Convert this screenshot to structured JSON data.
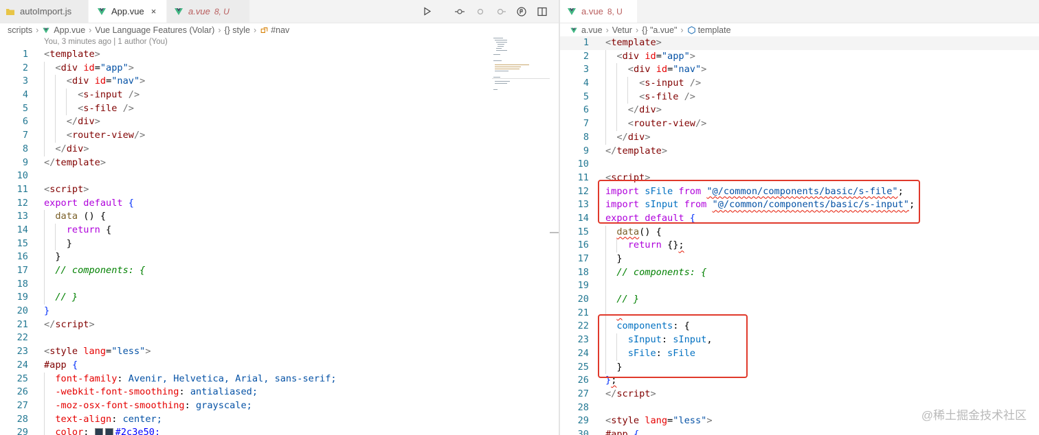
{
  "left": {
    "tabs": [
      {
        "label": "autoImport.js",
        "icon": "js-file-icon"
      },
      {
        "label": "App.vue",
        "icon": "vue-file-icon",
        "close": "×"
      },
      {
        "label": "a.vue",
        "icon": "vue-file-icon",
        "status": "8, U"
      }
    ],
    "actions": [
      "run-icon",
      "open-changes-icon",
      "go-back-icon",
      "go-forward-icon",
      "timeline-icon",
      "split-editor-icon",
      "more-icon"
    ],
    "breadcrumb": [
      "scripts",
      "App.vue",
      "Vue Language Features (Volar)",
      "{} style",
      "#nav"
    ],
    "blame": "You, 3 minutes ago | 1 author (You)",
    "line_numbers": [
      "1",
      "2",
      "3",
      "4",
      "5",
      "6",
      "7",
      "8",
      "9",
      "10",
      "11",
      "12",
      "13",
      "14",
      "15",
      "16",
      "17",
      "18",
      "19",
      "20",
      "21",
      "22",
      "23",
      "24",
      "25",
      "26",
      "27",
      "28",
      "29"
    ],
    "code": {
      "l1": "template",
      "l2a": "div",
      "l2b": "id",
      "l2c": "\"app\"",
      "l3a": "div",
      "l3b": "id",
      "l3c": "\"nav\"",
      "l4": "s-input",
      "l5": "s-file",
      "l6": "div",
      "l7": "router-view",
      "l8": "div",
      "l9": "template",
      "l11": "script",
      "l12a": "export",
      "l12b": "default",
      "l13": "data",
      "l14": "return",
      "l17": "// components: {",
      "l19": "// }",
      "l21": "script",
      "l23a": "style",
      "l23b": "lang",
      "l23c": "\"less\"",
      "l24": "#app",
      "l25a": "font-family",
      "l25b": "Avenir, Helvetica, Arial, sans-serif;",
      "l26a": "-webkit-font-smoothing",
      "l26b": "antialiased;",
      "l27a": "-moz-osx-font-smoothing",
      "l27b": "grayscale;",
      "l28a": "text-align",
      "l28b": "center;",
      "l29a": "color",
      "l29b": "#2c3e50;"
    }
  },
  "right": {
    "tab": {
      "label": "a.vue",
      "status": "8, U",
      "icon": "vue-file-icon"
    },
    "breadcrumb": [
      "a.vue",
      "Vetur",
      "{} \"a.vue\"",
      "template"
    ],
    "line_numbers": [
      "1",
      "2",
      "3",
      "4",
      "5",
      "6",
      "7",
      "8",
      "9",
      "10",
      "11",
      "12",
      "13",
      "14",
      "15",
      "16",
      "17",
      "18",
      "19",
      "20",
      "21",
      "22",
      "23",
      "24",
      "25",
      "26",
      "27",
      "28",
      "29",
      "30"
    ],
    "code": {
      "l1": "template",
      "l2a": "div",
      "l2b": "id",
      "l2c": "\"app\"",
      "l3a": "div",
      "l3b": "id",
      "l3c": "\"nav\"",
      "l4": "s-input",
      "l5": "s-file",
      "l6": "div",
      "l7": "router-view",
      "l8": "div",
      "l9": "template",
      "l11": "script",
      "l12a": "import",
      "l12b": "sFile",
      "l12c": "from",
      "l12d": "\"@/common/components/basic/s-file\"",
      "l13a": "import",
      "l13b": "sInput",
      "l13c": "from",
      "l13d": "\"@/common/components/basic/s-input\"",
      "l14a": "export",
      "l14b": "default",
      "l15": "data",
      "l16": "return",
      "l18": "// components: {",
      "l20": "// }",
      "l22": "components",
      "l23a": "sInput",
      "l23b": "sInput",
      "l24a": "sFile",
      "l24b": "sFile",
      "l27": "script",
      "l29a": "style",
      "l29b": "lang",
      "l29c": "\"less\"",
      "l30": "#app"
    }
  },
  "watermark": "@稀土掘金技术社区",
  "colors": {
    "highlight_box": "#e0392b",
    "line_number": "#237893",
    "vue_icon": "#41b883",
    "js_icon": "#e8c547"
  }
}
